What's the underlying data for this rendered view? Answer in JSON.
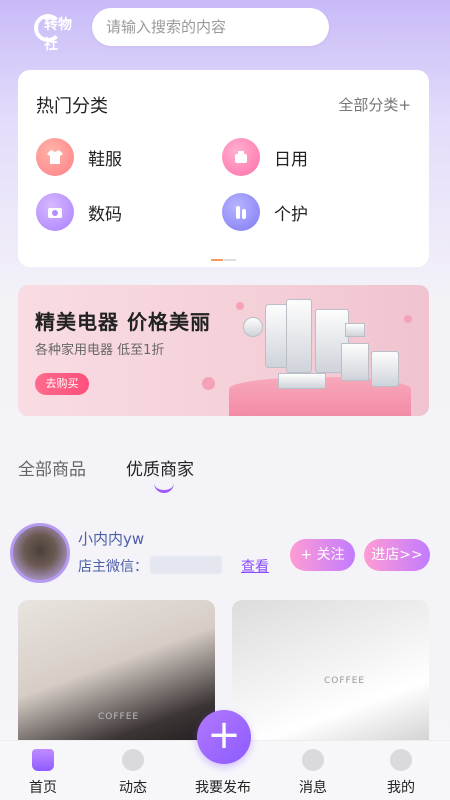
{
  "header": {
    "logo_text": "转物社",
    "search_placeholder": "请输入搜索的内容"
  },
  "categories": {
    "title": "热门分类",
    "all_label": "全部分类+",
    "items": [
      {
        "label": "鞋服",
        "icon": "clothing-icon",
        "color": "#ff8f8f"
      },
      {
        "label": "日用",
        "icon": "daily-goods-icon",
        "color": "#ff86b4"
      },
      {
        "label": "数码",
        "icon": "camera-icon",
        "color": "#b48cff"
      },
      {
        "label": "个护",
        "icon": "personal-care-icon",
        "color": "#8f8cff"
      }
    ]
  },
  "banner": {
    "title": "精美电器 价格美丽",
    "subtitle": "各种家用电器 低至1折",
    "button": "去购买"
  },
  "tabs": {
    "items": [
      "全部商品",
      "优质商家"
    ],
    "active": 1
  },
  "shop": {
    "name": "小内内yw",
    "wechat_label": "店主微信：",
    "view_link": "查看",
    "follow_button": "+ 关注",
    "enter_button": "进店>>"
  },
  "products": [
    {
      "tag": "COFFEE"
    },
    {
      "tag": "COFFEE"
    }
  ],
  "tabbar": {
    "items": [
      {
        "label": "首页",
        "icon": "home-icon"
      },
      {
        "label": "动态",
        "icon": "compass-icon"
      },
      {
        "label": "我要发布",
        "icon": "plus-icon"
      },
      {
        "label": "消息",
        "icon": "message-icon"
      },
      {
        "label": "我的",
        "icon": "profile-icon"
      }
    ],
    "active": 0
  },
  "colors": {
    "accent": "#9a5cff",
    "banner_button": "#ff5a80"
  }
}
